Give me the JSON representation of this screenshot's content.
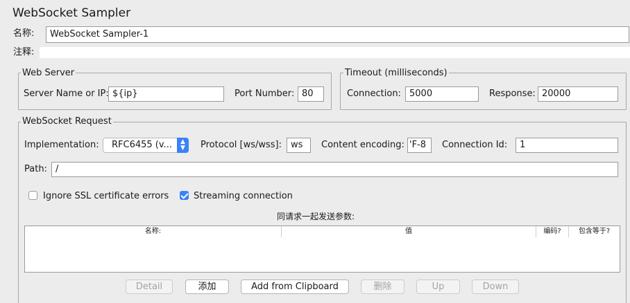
{
  "title": "WebSocket Sampler",
  "name_label": "名称:",
  "name_value": "WebSocket Sampler-1",
  "comment_label": "注释:",
  "comment_value": "",
  "web_server": {
    "legend": "Web Server",
    "server_label": "Server Name or IP:",
    "server_value": "${ip}",
    "port_label": "Port Number:",
    "port_value": "80"
  },
  "timeout": {
    "legend": "Timeout (milliseconds)",
    "connection_label": "Connection:",
    "connection_value": "5000",
    "response_label": "Response:",
    "response_value": "20000"
  },
  "request": {
    "legend": "WebSocket Request",
    "implementation_label": "Implementation:",
    "implementation_value": "RFC6455 (v...",
    "protocol_label": "Protocol [ws/wss]:",
    "protocol_value": "ws",
    "encoding_label": "Content encoding:",
    "encoding_value": "'F-8",
    "connection_id_label": "Connection Id:",
    "connection_id_value": "1",
    "path_label": "Path:",
    "path_value": "/",
    "ignore_ssl_label": "Ignore SSL certificate errors",
    "ignore_ssl_checked": false,
    "streaming_label": "Streaming connection",
    "streaming_checked": true
  },
  "params": {
    "caption": "同请求一起发送参数:",
    "columns": [
      "名称:",
      "值",
      "编码?",
      "包含等于?"
    ]
  },
  "buttons": {
    "detail": "Detail",
    "add": "添加",
    "add_clipboard": "Add from Clipboard",
    "delete": "删除",
    "up": "Up",
    "down": "Down"
  },
  "colors": {
    "accent": "#3b82f6",
    "background": "#ececec"
  }
}
